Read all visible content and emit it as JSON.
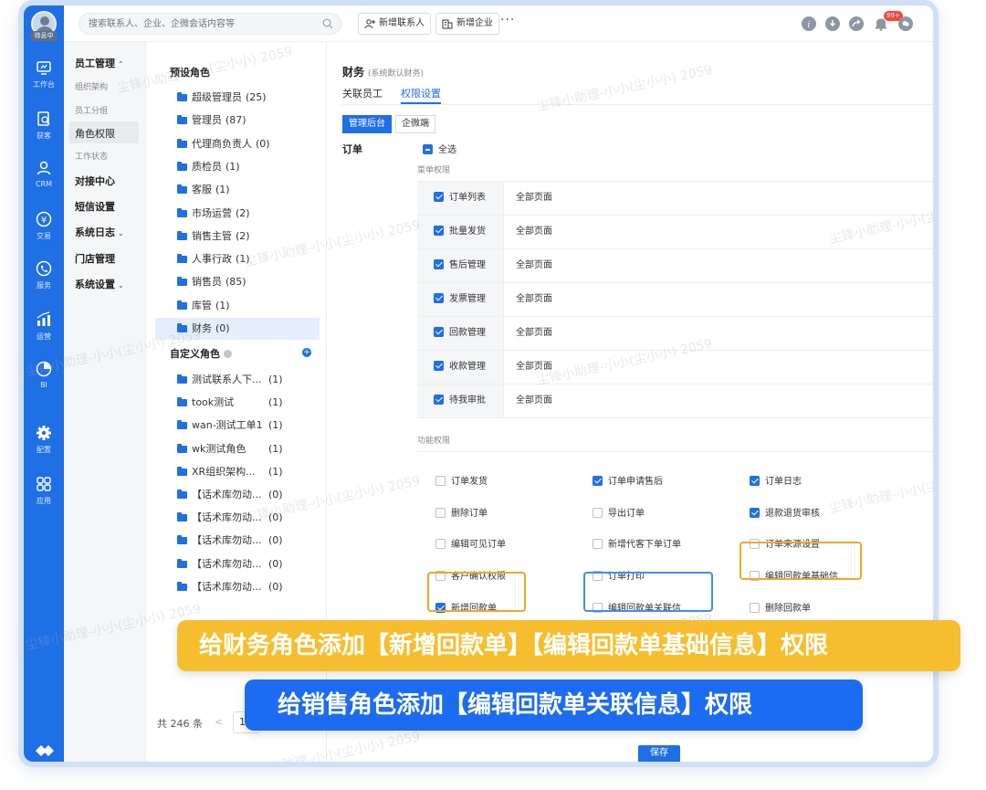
{
  "user": {
    "tag": "待息中"
  },
  "nav": [
    {
      "label": "工作台",
      "icon": "dashboard-icon"
    },
    {
      "label": "获客",
      "icon": "search-doc-icon"
    },
    {
      "label": "CRM",
      "icon": "person-icon"
    },
    {
      "label": "交易",
      "icon": "yen-icon"
    },
    {
      "label": "服务",
      "icon": "phone-icon"
    },
    {
      "label": "运营",
      "icon": "chart-icon"
    },
    {
      "label": "BI",
      "icon": "pie-icon"
    },
    {
      "label": "配置",
      "icon": "gear-icon"
    },
    {
      "label": "应用",
      "icon": "grid-icon"
    }
  ],
  "topbar": {
    "search_placeholder": "搜索联系人、企业、企微会话内容等",
    "new_contact": "新增联系人",
    "new_company": "新增企业",
    "more": "···",
    "badge": "99+"
  },
  "submenu": {
    "group1": "员工管理",
    "items1": [
      "组织架构",
      "员工分组",
      "角色权限",
      "工作状态"
    ],
    "others": [
      "对接中心",
      "短信设置",
      "系统日志",
      "门店管理",
      "系统设置"
    ]
  },
  "roles": {
    "preset_heading": "预设角色",
    "preset": [
      {
        "name": "超级管理员",
        "count": "(25)"
      },
      {
        "name": "管理员",
        "count": "(87)"
      },
      {
        "name": "代理商负责人",
        "count": "(0)"
      },
      {
        "name": "质检员",
        "count": "(1)"
      },
      {
        "name": "客服",
        "count": "(1)"
      },
      {
        "name": "市场运营",
        "count": "(2)"
      },
      {
        "name": "销售主管",
        "count": "(2)"
      },
      {
        "name": "人事行政",
        "count": "(1)"
      },
      {
        "name": "销售员",
        "count": "(85)"
      },
      {
        "name": "库管",
        "count": "(1)"
      },
      {
        "name": "财务",
        "count": "(0)"
      }
    ],
    "custom_heading": "自定义角色",
    "custom": [
      {
        "name": "测试联系人下...",
        "count": "(1)"
      },
      {
        "name": "took测试",
        "count": "(1)"
      },
      {
        "name": "wan-测试工单1",
        "count": "(1)"
      },
      {
        "name": "wk测试角色",
        "count": "(1)"
      },
      {
        "name": "XR组织架构...",
        "count": "(1)"
      },
      {
        "name": "【话术库勿动...",
        "count": "(0)"
      },
      {
        "name": "【话术库勿动...",
        "count": "(0)"
      },
      {
        "name": "【话术库勿动...",
        "count": "(0)"
      },
      {
        "name": "【话术库勿动...",
        "count": "(0)"
      },
      {
        "name": "【话术库勿动...",
        "count": "(0)"
      }
    ],
    "total": "共 246 条",
    "prev": "<",
    "page": "1"
  },
  "main": {
    "title": "财务",
    "title_sub": "(系统默认财务)",
    "tabs": [
      "关联员工",
      "权限设置"
    ],
    "seg": [
      "管理后台",
      "企微端"
    ],
    "order_label": "订单",
    "select_all": "全选",
    "menu_section": "菜单权限",
    "menu_rows": [
      {
        "name": "订单列表",
        "scope": "全部页面"
      },
      {
        "name": "批量发货",
        "scope": "全部页面"
      },
      {
        "name": "售后管理",
        "scope": "全部页面"
      },
      {
        "name": "发票管理",
        "scope": "全部页面"
      },
      {
        "name": "回款管理",
        "scope": "全部页面"
      },
      {
        "name": "收款管理",
        "scope": "全部页面"
      },
      {
        "name": "待我审批",
        "scope": "全部页面"
      }
    ],
    "func_section": "功能权限",
    "func_rows": [
      [
        {
          "label": "订单发货",
          "checked": false
        },
        {
          "label": "订单申请售后",
          "checked": true
        },
        {
          "label": "订单日志",
          "checked": true
        }
      ],
      [
        {
          "label": "删除订单",
          "checked": false
        },
        {
          "label": "导出订单",
          "checked": false
        },
        {
          "label": "退款退货审核",
          "checked": true
        }
      ],
      [
        {
          "label": "编辑可见订单",
          "checked": false
        },
        {
          "label": "新增代客下单订单",
          "checked": false
        },
        {
          "label": "订单来源设置",
          "checked": false
        }
      ],
      [
        {
          "label": "客户确认权限",
          "checked": false
        },
        {
          "label": "订单打印",
          "checked": false
        },
        {
          "label": "编辑回款单基础信...",
          "checked": false
        }
      ],
      [
        {
          "label": "新增回款单",
          "checked": true
        },
        {
          "label": "编辑回款单关联信...",
          "checked": false
        },
        {
          "label": "删除回款单",
          "checked": false
        }
      ]
    ],
    "save": "保存"
  },
  "watermark": "尘锋小助理-小小(尘小小) 2059",
  "banners": {
    "yellow": "给财务角色添加【新增回款单】【编辑回款单基础信息】权限",
    "blue": "给销售角色添加【编辑回款单关联信息】权限"
  },
  "colors": {
    "accent": "#1f6fe5",
    "highlight_orange": "#f3a529",
    "highlight_blue": "#3d8ef0",
    "banner_yellow": "#f6be2f",
    "banner_blue": "#1b6cf0"
  }
}
